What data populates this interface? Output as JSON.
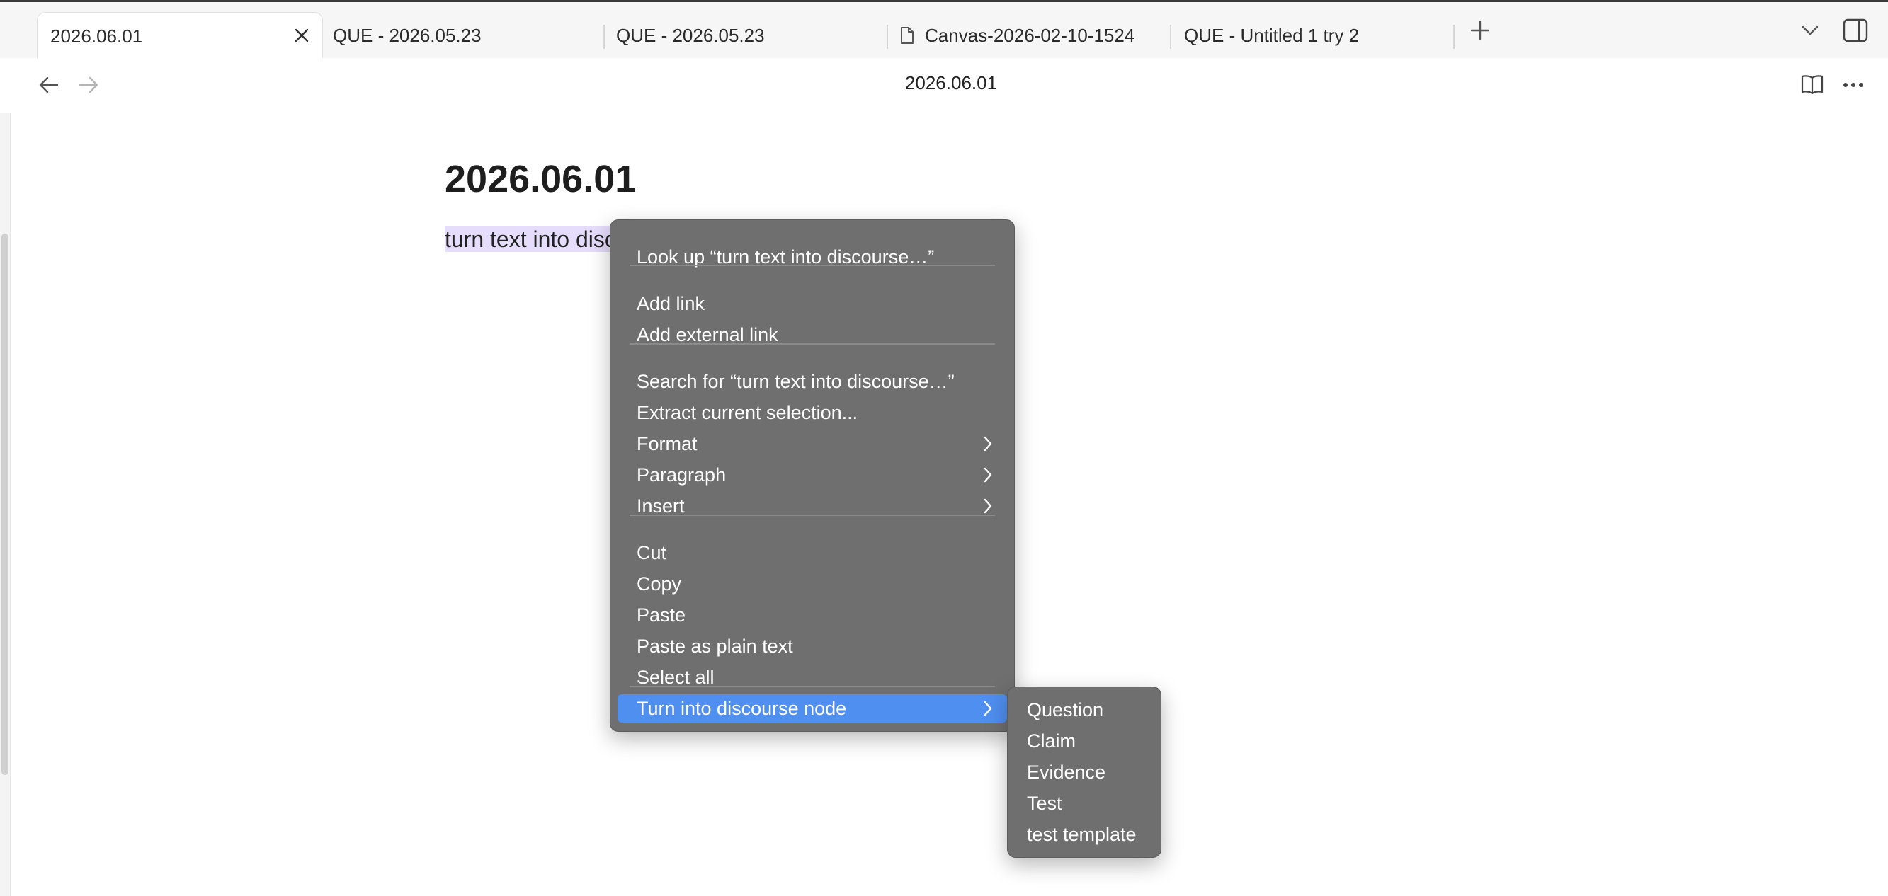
{
  "tabs": [
    {
      "label": "2026.06.01",
      "active": true
    },
    {
      "label": "QUE - 2026.05.23"
    },
    {
      "label": "QUE - 2026.05.23"
    },
    {
      "label": "Canvas-2026-02-10-1524",
      "icon": "file-icon"
    },
    {
      "label": "QUE - Untitled 1 try 2"
    }
  ],
  "nav": {
    "title": "2026.06.01"
  },
  "document": {
    "title": "2026.06.01",
    "line_text": "turn text into discourse node"
  },
  "context_menu": {
    "items": [
      {
        "label": "Look up “turn text into discourse…”"
      },
      {
        "label": "Add link"
      },
      {
        "label": "Add external link"
      },
      {
        "label": "Search for “turn text into discourse…”"
      },
      {
        "label": "Extract current selection..."
      },
      {
        "label": "Format",
        "submenu": true
      },
      {
        "label": "Paragraph",
        "submenu": true
      },
      {
        "label": "Insert",
        "submenu": true
      },
      {
        "label": "Cut"
      },
      {
        "label": "Copy"
      },
      {
        "label": "Paste"
      },
      {
        "label": "Paste as plain text"
      },
      {
        "label": "Select all"
      },
      {
        "label": "Turn into discourse node",
        "submenu": true,
        "highlighted": true
      }
    ]
  },
  "submenu": {
    "items": [
      "Question",
      "Claim",
      "Evidence",
      "Test",
      "test template"
    ]
  },
  "colors": {
    "menu_bg": "#6f6f6f",
    "menu_highlight": "#4f8ff0",
    "selection_highlight": "#e6dcfb"
  }
}
